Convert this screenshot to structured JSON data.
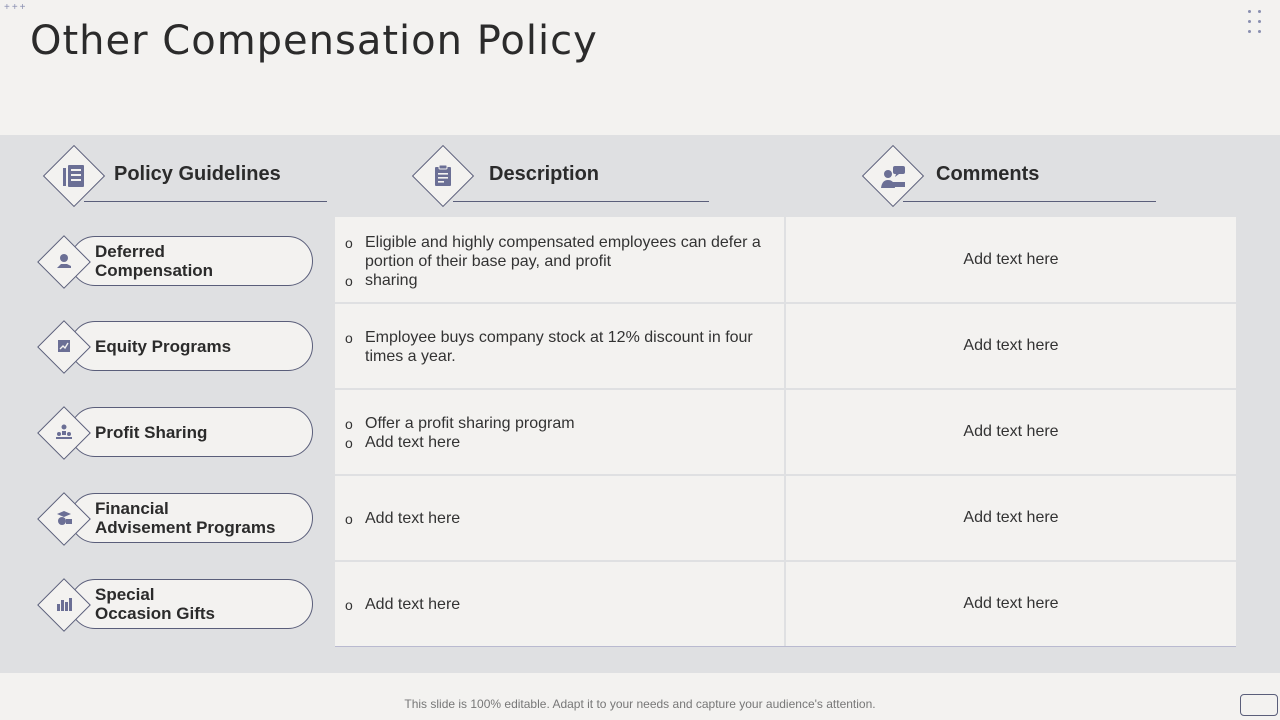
{
  "title": "Other Compensation Policy",
  "headers": {
    "policy": "Policy Guidelines",
    "description": "Description",
    "comments": "Comments"
  },
  "rows": [
    {
      "policy_line1": "Deferred",
      "policy_line2": "Compensation",
      "desc": [
        "Eligible and highly compensated employees can defer a portion of their base pay, and profit",
        "sharing"
      ],
      "comment": "Add text here"
    },
    {
      "policy_line1": "Equity Programs",
      "policy_line2": "",
      "desc": [
        "Employee buys company stock at 12% discount in four times a year."
      ],
      "comment": "Add text here"
    },
    {
      "policy_line1": "Profit Sharing",
      "policy_line2": "",
      "desc": [
        "Offer a profit sharing program",
        "Add text here"
      ],
      "comment": "Add text here"
    },
    {
      "policy_line1": "Financial",
      "policy_line2": "Advisement Programs",
      "desc": [
        "Add text here"
      ],
      "comment": "Add text here"
    },
    {
      "policy_line1": "Special",
      "policy_line2": "Occasion Gifts",
      "desc": [
        "Add text here"
      ],
      "comment": "Add text here"
    }
  ],
  "footer": "This slide is 100% editable. Adapt it to your needs and capture your audience's attention.",
  "colors": {
    "accent": "#5a5e7a",
    "icon": "#6b6f95",
    "band": "#dfe0e2",
    "background": "#f3f2f0"
  }
}
